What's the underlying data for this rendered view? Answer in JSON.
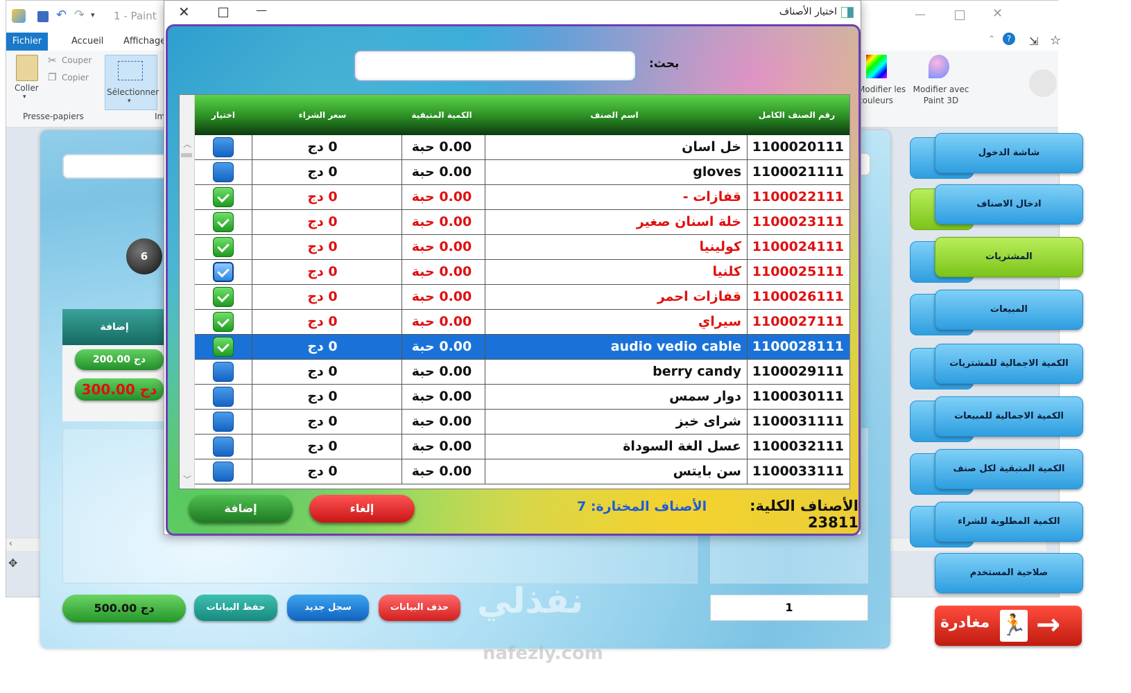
{
  "paint": {
    "title": "1 - Paint",
    "menu": [
      "Fichier",
      "Accueil",
      "Affichage"
    ],
    "clipboard": {
      "paste": "Coller",
      "cut": "Couper",
      "copy": "Copier",
      "group": "Presse-papiers"
    },
    "select": "Sélectionner",
    "image_group": "Im",
    "edit_colors": "Modifier les couleurs",
    "paint3d": "Modifier avec Paint 3D"
  },
  "main": {
    "right_nav": [
      "شاشة الدخول",
      "ادخال الاصناف",
      "المشتريات",
      "المبيعات",
      "الكمية الاجمالية للمشتريات",
      "الكمية الاجمالية للمبيعات",
      "الكمية المتبقية لكل صنف",
      "الكمية المطلوبة للشراء",
      "صلاحية المستخدم"
    ],
    "exit_label": "مغادرة",
    "add_header": "إضافة",
    "amount1": "200.00 دج",
    "amount2": "300.00 دج",
    "total": "500.00 دج",
    "btn_save": "حفظ البيانات",
    "btn_new": "سجل جديد",
    "btn_delete": "حذف البيانات",
    "counter": "1",
    "badge": "6",
    "watermark": "نفذلي",
    "watermark_url": "nafezly.com"
  },
  "dialog": {
    "title": "اختيار الأصناف",
    "search_label": "بحث:",
    "search_value": "",
    "columns": [
      "رقم الصنف الكامل",
      "اسم الصنف",
      "الكمية المتبقية",
      "سعر الشراء",
      "اختيار"
    ],
    "rows": [
      {
        "code": "1100020111",
        "name": "خل اسان",
        "qty": "0.00 حبة",
        "price": "0 دج",
        "checked": false,
        "style": "blk"
      },
      {
        "code": "1100021111",
        "name": "gloves",
        "qty": "0.00 حبة",
        "price": "0 دج",
        "checked": false,
        "style": "blk"
      },
      {
        "code": "1100022111",
        "name": "قفازات -",
        "qty": "0.00 حبة",
        "price": "0 دج",
        "checked": true,
        "style": "red"
      },
      {
        "code": "1100023111",
        "name": "خلة اسنان صغير",
        "qty": "0.00 حبة",
        "price": "0 دج",
        "checked": true,
        "style": "red"
      },
      {
        "code": "1100024111",
        "name": "كولينيا",
        "qty": "0.00 حبة",
        "price": "0 دج",
        "checked": true,
        "style": "red"
      },
      {
        "code": "1100025111",
        "name": "كلنيا",
        "qty": "0.00 حبة",
        "price": "0 دج",
        "checked": true,
        "style": "red",
        "hl": true
      },
      {
        "code": "1100026111",
        "name": "قفازات احمر",
        "qty": "0.00 حبة",
        "price": "0 دج",
        "checked": true,
        "style": "red"
      },
      {
        "code": "1100027111",
        "name": "سيراي",
        "qty": "0.00 حبة",
        "price": "0 دج",
        "checked": true,
        "style": "red"
      },
      {
        "code": "1100028111",
        "name": "audio vedio cable",
        "qty": "0.00 حبة",
        "price": "0 دج",
        "checked": true,
        "style": "wht",
        "selected": true
      },
      {
        "code": "1100029111",
        "name": "berry candy",
        "qty": "0.00 حبة",
        "price": "0 دج",
        "checked": false,
        "style": "blk"
      },
      {
        "code": "1100030111",
        "name": "دوار سمس",
        "qty": "0.00 حبة",
        "price": "0 دج",
        "checked": false,
        "style": "blk"
      },
      {
        "code": "1100031111",
        "name": "شراى خبز",
        "qty": "0.00 حبة",
        "price": "0 دج",
        "checked": false,
        "style": "blk"
      },
      {
        "code": "1100032111",
        "name": "عسل الغة السوداة",
        "qty": "0.00 حبة",
        "price": "0 دج",
        "checked": false,
        "style": "blk"
      },
      {
        "code": "1100033111",
        "name": "سن بايتس",
        "qty": "0.00 حبة",
        "price": "0 دج",
        "checked": false,
        "style": "blk"
      }
    ],
    "total_label": "الأصناف الكلية:",
    "total_value": "23811",
    "selected_label": "الأصناف المختارة:",
    "selected_value": "7",
    "btn_add": "إضافة",
    "btn_cancel": "إلغاء"
  }
}
